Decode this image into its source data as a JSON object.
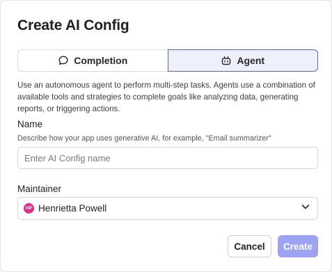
{
  "dialog": {
    "title": "Create AI Config"
  },
  "mode_toggle": {
    "options": [
      {
        "label": "Completion",
        "icon": "speech-bubble-icon",
        "selected": false
      },
      {
        "label": "Agent",
        "icon": "robot-icon",
        "selected": true
      }
    ]
  },
  "description": "Use an autonomous agent to perform multi-step tasks. Agents use a combination of available tools and strategies to complete goals like analyzing data, generating reports, or triggering actions.",
  "name_field": {
    "label": "Name",
    "hint": "Describe how your app uses generative AI, for example, \"Email summarizer\"",
    "placeholder": "Enter AI Config name",
    "value": ""
  },
  "maintainer_field": {
    "label": "Maintainer",
    "avatar_initials": "HP",
    "avatar_color": "#e02f87",
    "value": "Henrietta Powell"
  },
  "actions": {
    "cancel_label": "Cancel",
    "create_label": "Create",
    "create_color": "#9ba3f2"
  }
}
